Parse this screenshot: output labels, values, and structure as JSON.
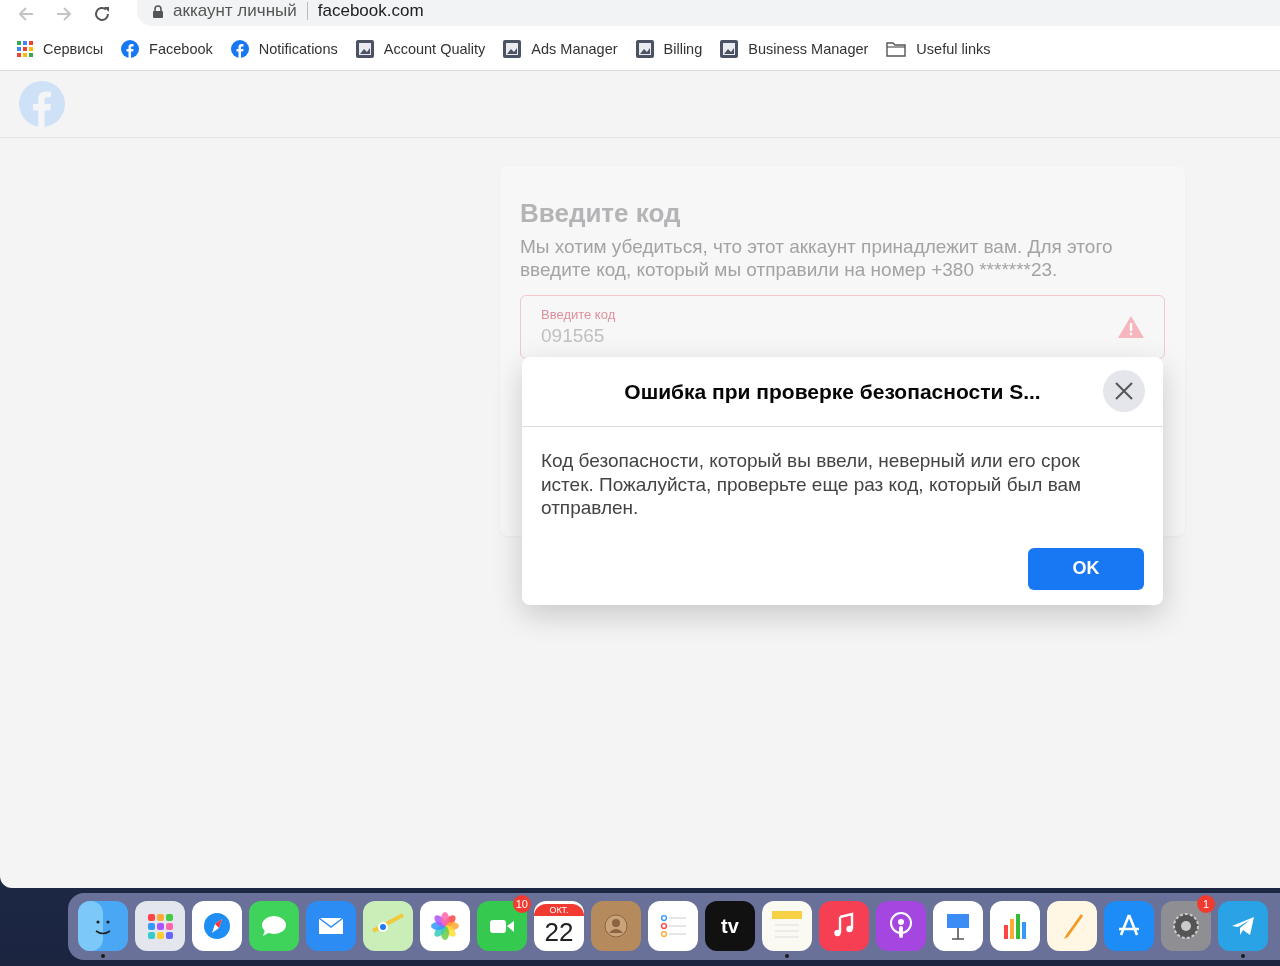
{
  "browser": {
    "address": {
      "page_title": "аккаунт личный",
      "url": "facebook.com"
    },
    "bookmarks": [
      {
        "kind": "apps",
        "label": "Сервисы"
      },
      {
        "kind": "facebook",
        "label": "Facebook"
      },
      {
        "kind": "facebook",
        "label": "Notifications"
      },
      {
        "kind": "page",
        "label": "Account Quality"
      },
      {
        "kind": "page",
        "label": "Ads Manager"
      },
      {
        "kind": "page",
        "label": "Billing"
      },
      {
        "kind": "page",
        "label": "Business Manager"
      },
      {
        "kind": "folder",
        "label": "Useful links"
      }
    ]
  },
  "form": {
    "title": "Введите код",
    "text": "Мы хотим убедиться, что этот аккаунт принадлежит вам. Для этого введите код, который мы отправили на номер +380 *******23.",
    "field": {
      "label": "Введите код",
      "value": "091565",
      "error": true
    }
  },
  "dialog": {
    "title": "Ошибка при проверке безопасности S...",
    "message": "Код безопасности, который вы ввели, неверный или его срок истек. Пожалуйста, проверьте еще раз код, который был вам отправлен.",
    "button": "OK"
  },
  "dock": [
    {
      "kind": "finder",
      "running": true
    },
    {
      "kind": "launchpad",
      "running": false
    },
    {
      "kind": "safari",
      "running": false
    },
    {
      "kind": "messages",
      "running": false
    },
    {
      "kind": "mail",
      "running": false
    },
    {
      "kind": "maps",
      "running": false
    },
    {
      "kind": "photos",
      "running": false
    },
    {
      "kind": "facetime",
      "running": false,
      "badge": "10"
    },
    {
      "kind": "calendar",
      "running": false,
      "month": "ОКТ.",
      "day": "22"
    },
    {
      "kind": "contacts",
      "running": false
    },
    {
      "kind": "reminders",
      "running": false
    },
    {
      "kind": "tv",
      "running": false,
      "label": "tv"
    },
    {
      "kind": "notes",
      "running": true
    },
    {
      "kind": "music",
      "running": false
    },
    {
      "kind": "podcasts",
      "running": false
    },
    {
      "kind": "keynote",
      "running": false
    },
    {
      "kind": "numbers",
      "running": false
    },
    {
      "kind": "pages",
      "running": false
    },
    {
      "kind": "appstore",
      "running": false
    },
    {
      "kind": "settings",
      "running": false,
      "badge": "1"
    },
    {
      "kind": "telegram",
      "running": true
    }
  ]
}
